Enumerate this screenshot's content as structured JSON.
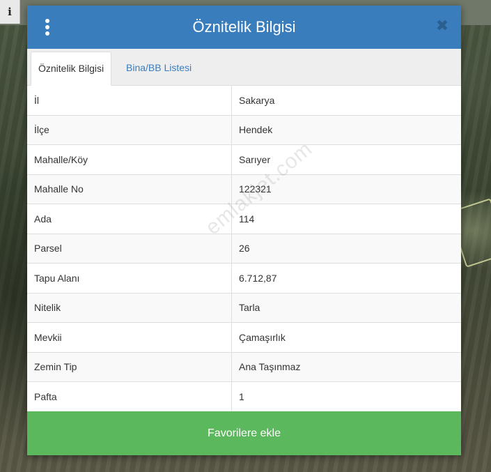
{
  "map": {
    "info_button": "i"
  },
  "dialog": {
    "title": "Öznitelik Bilgisi",
    "close_glyph": "✖",
    "tabs": [
      {
        "label": "Öznitelik Bilgisi",
        "active": true
      },
      {
        "label": "Bina/BB Listesi",
        "active": false
      }
    ],
    "rows": [
      {
        "key": "İl",
        "value": "Sakarya"
      },
      {
        "key": "İlçe",
        "value": "Hendek"
      },
      {
        "key": "Mahalle/Köy",
        "value": "Sarıyer"
      },
      {
        "key": "Mahalle No",
        "value": "122321"
      },
      {
        "key": "Ada",
        "value": "114"
      },
      {
        "key": "Parsel",
        "value": "26"
      },
      {
        "key": "Tapu Alanı",
        "value": "6.712,87"
      },
      {
        "key": "Nitelik",
        "value": "Tarla"
      },
      {
        "key": "Mevkii",
        "value": "Çamaşırlık"
      },
      {
        "key": "Zemin Tip",
        "value": "Ana Taşınmaz"
      },
      {
        "key": "Pafta",
        "value": "1"
      }
    ],
    "favorite_button": "Favorilere ekle",
    "watermark": "emlakjet.com"
  },
  "colors": {
    "header": "#3a7dbd",
    "favorite": "#5cb85c",
    "tab_link": "#3a7dbd"
  }
}
